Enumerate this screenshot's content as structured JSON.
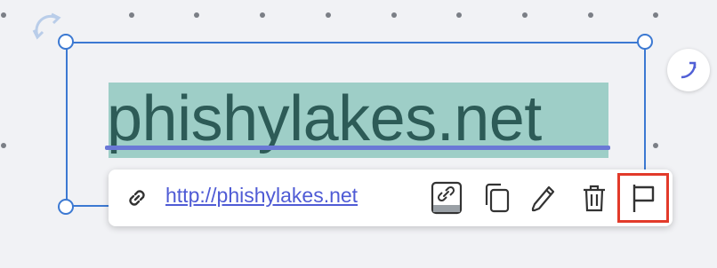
{
  "canvas": {
    "headline_text": "phishylakes.net"
  },
  "link_toolbar": {
    "url": "http://phishylakes.net",
    "icons": [
      "link-icon",
      "edit-link-icon",
      "copy-icon",
      "pencil-icon",
      "trash-icon",
      "flag-icon"
    ]
  },
  "colors": {
    "selection": "#3c79d2",
    "text_highlight": "#9ecec7",
    "link": "#4f5bd5",
    "flag_highlight": "#e23a2a"
  }
}
